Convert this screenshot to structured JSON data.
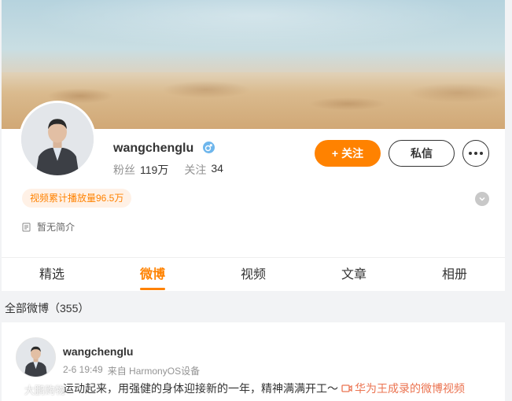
{
  "profile": {
    "username": "wangchenglu",
    "fans_label": "粉丝",
    "fans_count": "119万",
    "follow_label": "关注",
    "follow_count": "34",
    "video_plays": "视频累计播放量96.5万",
    "intro": "暂无简介"
  },
  "actions": {
    "follow_icon": "+",
    "follow_label": "关注",
    "message_label": "私信",
    "more_icon": "more-dots-icon"
  },
  "tabs": [
    "精选",
    "微博",
    "视频",
    "文章",
    "相册"
  ],
  "active_tab": "微博",
  "feed": {
    "count_label": "全部微博（355）"
  },
  "post": {
    "username": "wangchenglu",
    "date": "2-6 19:49",
    "source": "来自 HarmonyOS设备",
    "text": "运动起来，用强健的身体迎接新的一年，精神满满开工～",
    "link_label": "华为王成录的微博视频"
  },
  "watermark": "大鹏购物",
  "colors": {
    "accent": "#ff8200",
    "link": "#eb7350",
    "gender_male": "#6eb6ec"
  }
}
